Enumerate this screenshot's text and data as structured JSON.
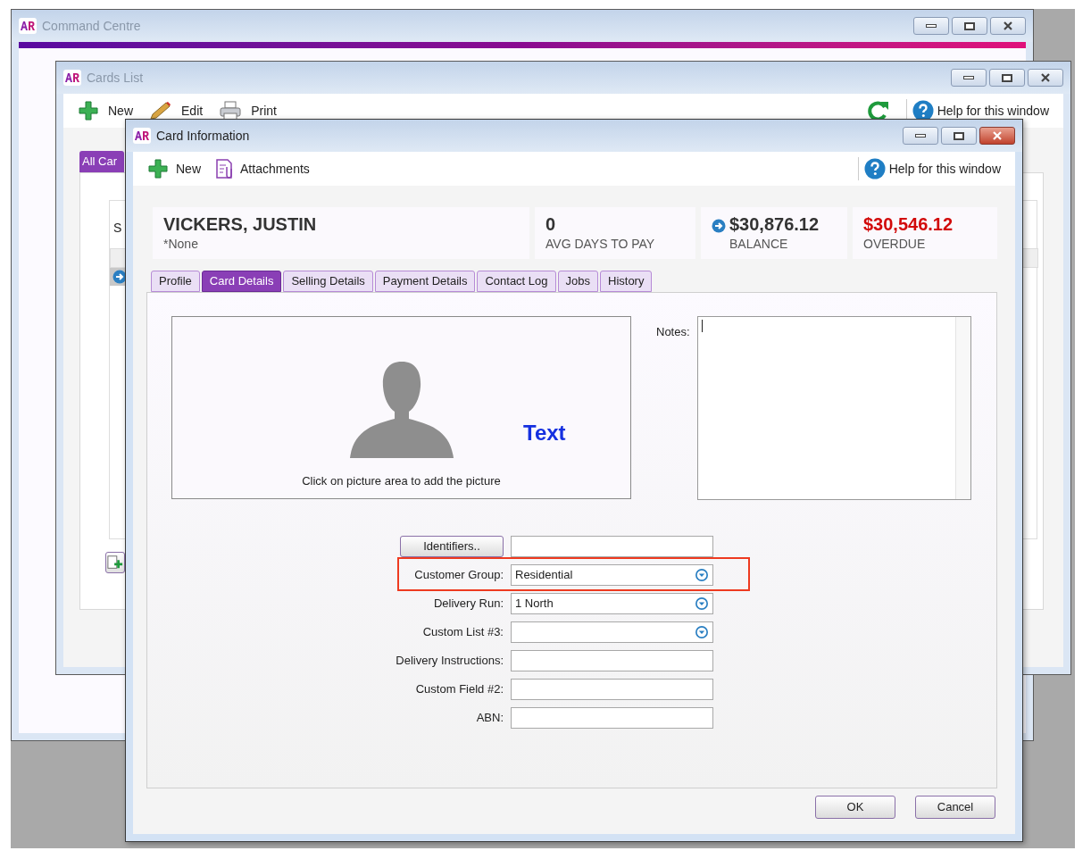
{
  "command_centre": {
    "title": "Command Centre"
  },
  "cards_list": {
    "title": "Cards List",
    "toolbar": [
      {
        "kind": "new",
        "label": "New"
      },
      {
        "kind": "edit",
        "label": "Edit"
      },
      {
        "kind": "print",
        "label": "Print"
      }
    ],
    "help": "Help for this window",
    "tab": "All Car",
    "search_label": "S"
  },
  "card_information": {
    "title": "Card Information",
    "toolbar": [
      {
        "kind": "new",
        "label": "New"
      },
      {
        "kind": "attachments",
        "label": "Attachments"
      }
    ],
    "help": "Help for this window",
    "name": "VICKERS, JUSTIN",
    "subtitle": "*None",
    "stats": [
      {
        "kind": "plain",
        "value": "0",
        "label": "AVG DAYS TO PAY"
      },
      {
        "kind": "link",
        "value": "$30,876.12",
        "label": "BALANCE"
      },
      {
        "kind": "overdue",
        "value": "$30,546.12",
        "label": "OVERDUE"
      }
    ],
    "tabs": [
      {
        "label": "Profile",
        "selected": false
      },
      {
        "label": "Card Details",
        "selected": true
      },
      {
        "label": "Selling Details",
        "selected": false
      },
      {
        "label": "Payment Details",
        "selected": false
      },
      {
        "label": "Contact Log",
        "selected": false
      },
      {
        "label": "Jobs",
        "selected": false
      },
      {
        "label": "History",
        "selected": false
      }
    ],
    "picture_hint": "Click on picture area to add the picture",
    "annotation": "Text",
    "notes_label": "Notes:",
    "identifiers_button": "Identifiers..",
    "fields": [
      {
        "label": "Customer Group:",
        "kind": "combo",
        "value": "Residential",
        "highlighted": true
      },
      {
        "label": "Delivery Run:",
        "kind": "combo",
        "value": "1 North",
        "highlighted": false
      },
      {
        "label": "Custom List #3:",
        "kind": "combo",
        "highlighted": false
      },
      {
        "label": "Delivery Instructions:",
        "kind": "text",
        "highlighted": false
      },
      {
        "label": "Custom Field #2:",
        "kind": "text",
        "highlighted": false
      },
      {
        "label": "ABN:",
        "kind": "text",
        "highlighted": false
      }
    ],
    "buttons": [
      "OK",
      "Cancel"
    ]
  }
}
